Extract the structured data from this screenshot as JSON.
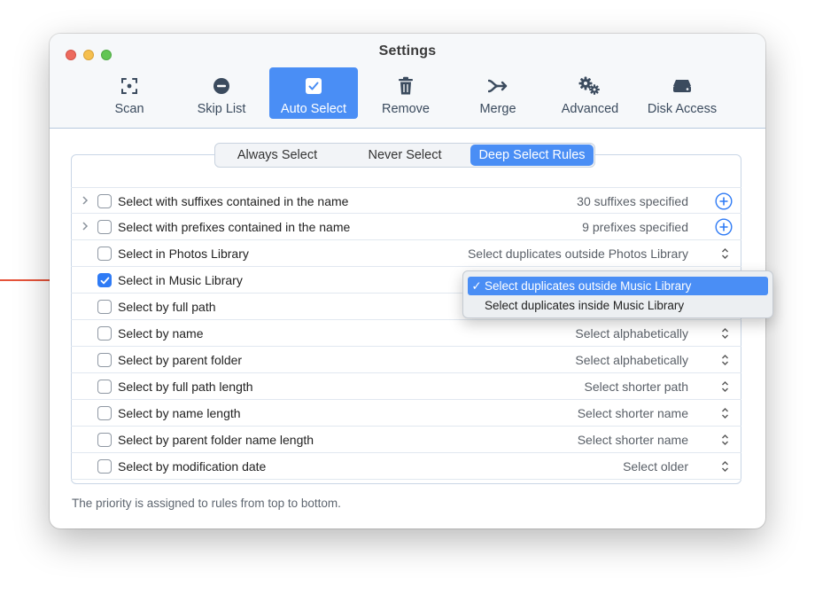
{
  "window": {
    "title": "Settings"
  },
  "toolbar": [
    {
      "label": "Scan",
      "icon": "scan-icon",
      "active": false
    },
    {
      "label": "Skip List",
      "icon": "minus-circle-icon",
      "active": false
    },
    {
      "label": "Auto Select",
      "icon": "checkbox-icon",
      "active": true
    },
    {
      "label": "Remove",
      "icon": "trash-icon",
      "active": false
    },
    {
      "label": "Merge",
      "icon": "merge-arrow-icon",
      "active": false
    },
    {
      "label": "Advanced",
      "icon": "gears-icon",
      "active": false
    },
    {
      "label": "Disk Access",
      "icon": "disk-icon",
      "active": false
    }
  ],
  "tabs": [
    {
      "label": "Always Select",
      "active": false
    },
    {
      "label": "Never Select",
      "active": false
    },
    {
      "label": "Deep Select Rules",
      "active": true
    }
  ],
  "rules": [
    {
      "label": "Select with suffixes contained in the name",
      "value": "30 suffixes specified",
      "checked": false,
      "expandable": true,
      "control": "plus"
    },
    {
      "label": "Select with prefixes contained in the name",
      "value": "9 prefixes specified",
      "checked": false,
      "expandable": true,
      "control": "plus"
    },
    {
      "label": "Select in Photos Library",
      "value": "Select duplicates outside Photos Library",
      "checked": false,
      "expandable": false,
      "control": "popup"
    },
    {
      "label": "Select in Music Library",
      "value": "",
      "checked": true,
      "expandable": false,
      "control": "none"
    },
    {
      "label": "Select by full path",
      "value": "",
      "checked": false,
      "expandable": false,
      "control": "none"
    },
    {
      "label": "Select by name",
      "value": "Select alphabetically",
      "checked": false,
      "expandable": false,
      "control": "popup"
    },
    {
      "label": "Select by parent folder",
      "value": "Select alphabetically",
      "checked": false,
      "expandable": false,
      "control": "popup"
    },
    {
      "label": "Select by full path length",
      "value": "Select shorter path",
      "checked": false,
      "expandable": false,
      "control": "popup"
    },
    {
      "label": "Select by name length",
      "value": "Select shorter name",
      "checked": false,
      "expandable": false,
      "control": "popup"
    },
    {
      "label": "Select by parent folder name length",
      "value": "Select shorter name",
      "checked": false,
      "expandable": false,
      "control": "popup"
    },
    {
      "label": "Select by modification date",
      "value": "Select older",
      "checked": false,
      "expandable": false,
      "control": "popup"
    }
  ],
  "dropdown": {
    "options": [
      {
        "label": "Select duplicates outside Music Library",
        "selected": true,
        "mark": "✓"
      },
      {
        "label": "Select duplicates inside Music Library",
        "selected": false,
        "mark": ""
      }
    ]
  },
  "footer": {
    "note": "The priority is assigned to rules from top to bottom."
  },
  "colors": {
    "accent": "#4a8ef5",
    "arrow": "#e5533a",
    "checkbox": "#2f7bf5"
  }
}
